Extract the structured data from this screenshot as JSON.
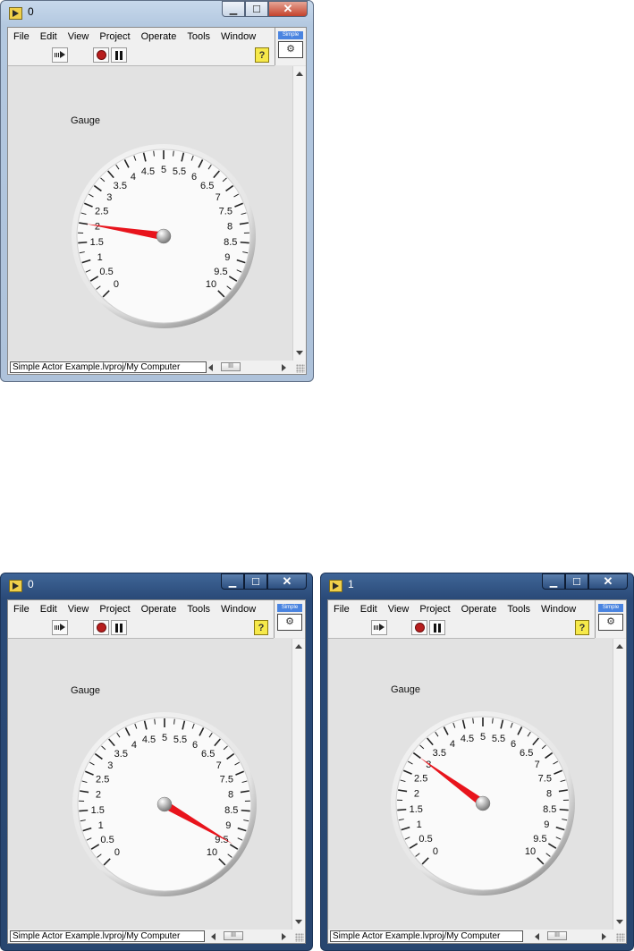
{
  "menu": [
    "File",
    "Edit",
    "View",
    "Project",
    "Operate",
    "Tools",
    "Window"
  ],
  "badge_label": "Simple",
  "help_label": "?",
  "scroll_thumb": "III",
  "gauge": {
    "min": 0,
    "max": 10,
    "tick_labels": [
      "0",
      "0.5",
      "1",
      "1.5",
      "2",
      "2.5",
      "3",
      "3.5",
      "4",
      "4.5",
      "5",
      "5.5",
      "6",
      "6.5",
      "7",
      "7.5",
      "8",
      "8.5",
      "9",
      "9.5",
      "10"
    ],
    "needle_color": "#e8141c"
  },
  "windows": [
    {
      "id": "top",
      "title": "0",
      "label": "Gauge",
      "value": 2.0,
      "status_path": "Simple Actor Example.lvproj/My Computer",
      "dark": false
    },
    {
      "id": "bottom-left",
      "title": "0",
      "label": "Gauge",
      "value": 9.45,
      "status_path": "Simple Actor Example.lvproj/My Computer",
      "dark": true
    },
    {
      "id": "bottom-right",
      "title": "1",
      "label": "Gauge",
      "value": 3.0,
      "status_path": "Simple Actor Example.lvproj/My Computer",
      "dark": true
    }
  ]
}
